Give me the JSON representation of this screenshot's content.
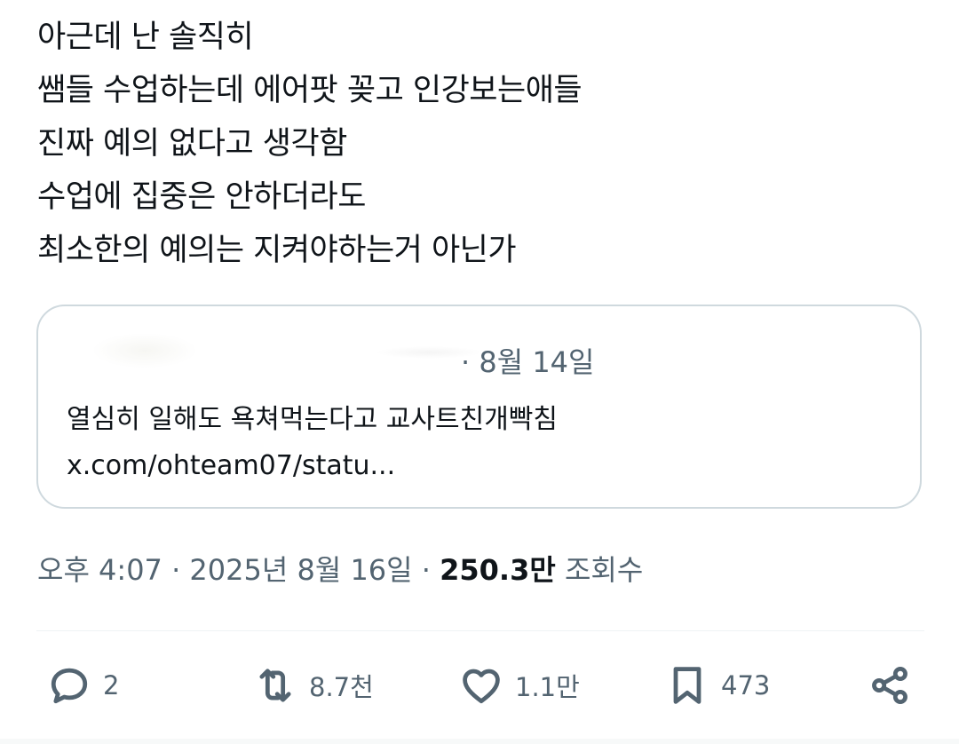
{
  "tweet": {
    "lines": [
      "아근데 난 솔직히",
      "쌤들 수업하는데 에어팟 꽂고 인강보는애들",
      "진짜 예의 없다고 생각함",
      "수업에 집중은 안하더라도",
      "최소한의 예의는 지켜야하는거 아닌가"
    ]
  },
  "quote": {
    "date": "· 8월 14일",
    "text": "열심히 일해도 욕쳐먹는다고 교사트친개빡침",
    "link": "x.com/ohteam07/statu..."
  },
  "meta": {
    "timestamp": "오후 4:07 · 2025년 8월 16일 · ",
    "views_value": "250.3만",
    "views_label": " 조회수"
  },
  "actions": {
    "reply": {
      "icon": "reply-icon",
      "count": "2"
    },
    "retweet": {
      "icon": "retweet-icon",
      "count": "8.7천"
    },
    "like": {
      "icon": "heart-icon",
      "count": "1.1만"
    },
    "bookmark": {
      "icon": "bookmark-icon",
      "count": "473"
    },
    "share": {
      "icon": "share-icon"
    }
  },
  "colors": {
    "text": "#0f1419",
    "secondary": "#536471",
    "border": "#cfd9de"
  }
}
